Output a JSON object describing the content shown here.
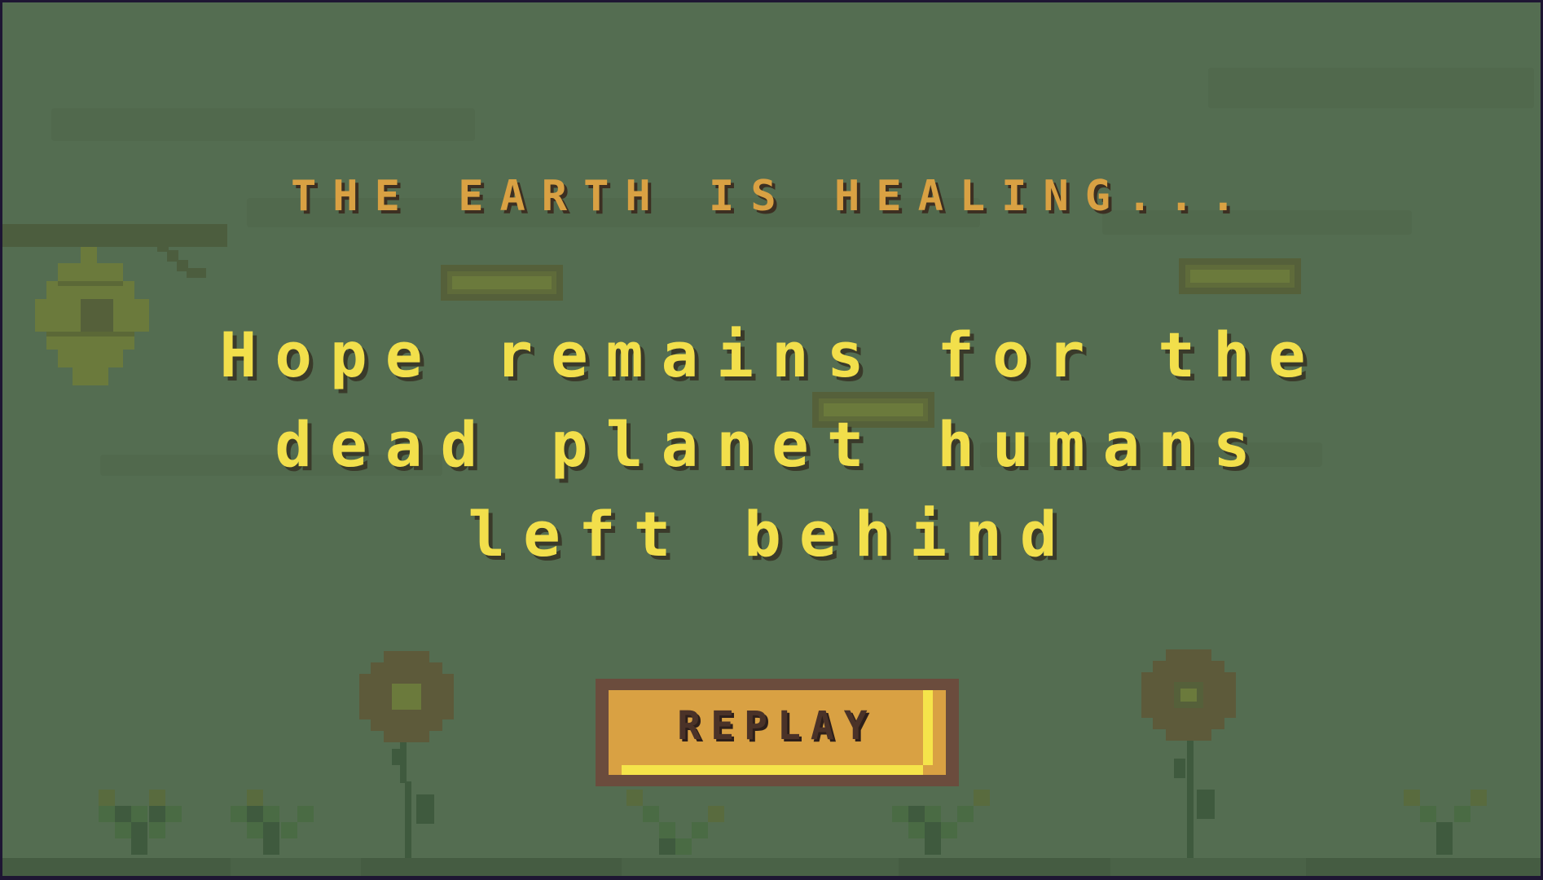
{
  "game": {
    "heading": "THE EARTH IS HEALING...",
    "message_lines": [
      "Hope remains for the",
      "dead planet humans",
      "left behind"
    ],
    "replay_label": "REPLAY"
  },
  "colors": {
    "background": "#546d51",
    "frame": "#1e1633",
    "heading_text": "#d9a143",
    "message_text": "#f2df4b",
    "button_fill": "#d9a143",
    "button_border": "#6b4c3d",
    "button_highlight": "#f5e44a"
  },
  "icons": [
    "beehive-icon",
    "sunflower-icon",
    "sprout-icon",
    "branch-platform-icon"
  ]
}
